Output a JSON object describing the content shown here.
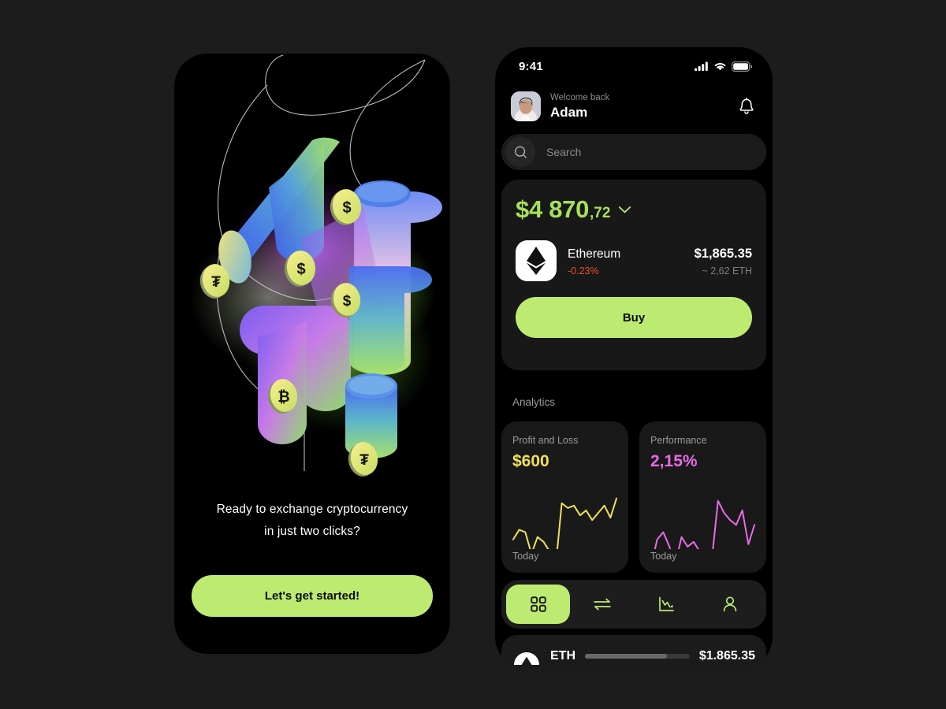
{
  "theme": {
    "page_bg": "#1c1c1c",
    "screen_bg": "#000000",
    "accent_green": "#bdeb72",
    "balance_green": "#a6e05a",
    "negative_red": "#e8502e",
    "profit_yellow": "#f2e05a",
    "performance_magenta": "#e96ae8",
    "card_bg": "#181818",
    "muted_text": "#9b9b9b"
  },
  "onboarding": {
    "headline_line1": "Ready to exchange cryptocurrency",
    "headline_line2": "in just two clicks?",
    "cta_label": "Let's get started!",
    "illustration": {
      "name": "crypto-3d-tubes-illustration",
      "coins": [
        {
          "symbol": "$",
          "name": "dollar-coin"
        },
        {
          "symbol": "₮",
          "name": "tether-coin"
        },
        {
          "symbol": "$",
          "name": "dollar-coin"
        },
        {
          "symbol": "$",
          "name": "dollar-coin"
        },
        {
          "symbol": "₿",
          "name": "bitcoin-coin"
        },
        {
          "symbol": "₮",
          "name": "tether-coin"
        }
      ]
    }
  },
  "dashboard": {
    "status_bar": {
      "time": "9:41",
      "icons": [
        "signal-icon",
        "wifi-icon",
        "battery-icon"
      ]
    },
    "header": {
      "welcome": "Welcome back",
      "name": "Adam",
      "avatar_name": "user-avatar",
      "bell_name": "notification-bell-icon"
    },
    "search": {
      "placeholder": "Search",
      "value": "",
      "icon": "search-icon"
    },
    "balance_card": {
      "amount": "$4 870",
      "cents": ",72",
      "chevron": "chevron-down-icon",
      "asset": {
        "logo": "ethereum-icon",
        "name": "Ethereum",
        "change": "-0.23%",
        "price": "$1,865.35",
        "amount": "~ 2,62 ETH"
      },
      "buy_label": "Buy"
    },
    "analytics": {
      "section_label": "Analytics",
      "cards": [
        {
          "title": "Profit and Loss",
          "value": "$600",
          "value_color": "#f2e05a",
          "footer": "Today",
          "spark_color": "#f2e05a",
          "spark_points": [
            52,
            44,
            46,
            64,
            50,
            54,
            62,
            74,
            22,
            26,
            24,
            32,
            28,
            36,
            30,
            24,
            34,
            18
          ]
        },
        {
          "title": "Performance",
          "value": "2,15%",
          "value_color": "#e96ae8",
          "footer": "Today",
          "spark_color": "#e96ae8",
          "spark_points": [
            74,
            52,
            46,
            58,
            72,
            50,
            58,
            54,
            62,
            66,
            68,
            20,
            30,
            36,
            40,
            28,
            56,
            40
          ]
        }
      ]
    },
    "nav": {
      "items": [
        {
          "name": "nav-dashboard",
          "icon": "grid-icon",
          "active": true
        },
        {
          "name": "nav-exchange",
          "icon": "swap-arrows-icon",
          "active": false
        },
        {
          "name": "nav-analytics",
          "icon": "chart-down-icon",
          "active": false
        },
        {
          "name": "nav-profile",
          "icon": "person-icon",
          "active": false
        }
      ]
    },
    "eth_strip": {
      "icon": "eth-white-icon",
      "label": "ETH",
      "price": "$1.865.35",
      "progress": 78
    }
  }
}
